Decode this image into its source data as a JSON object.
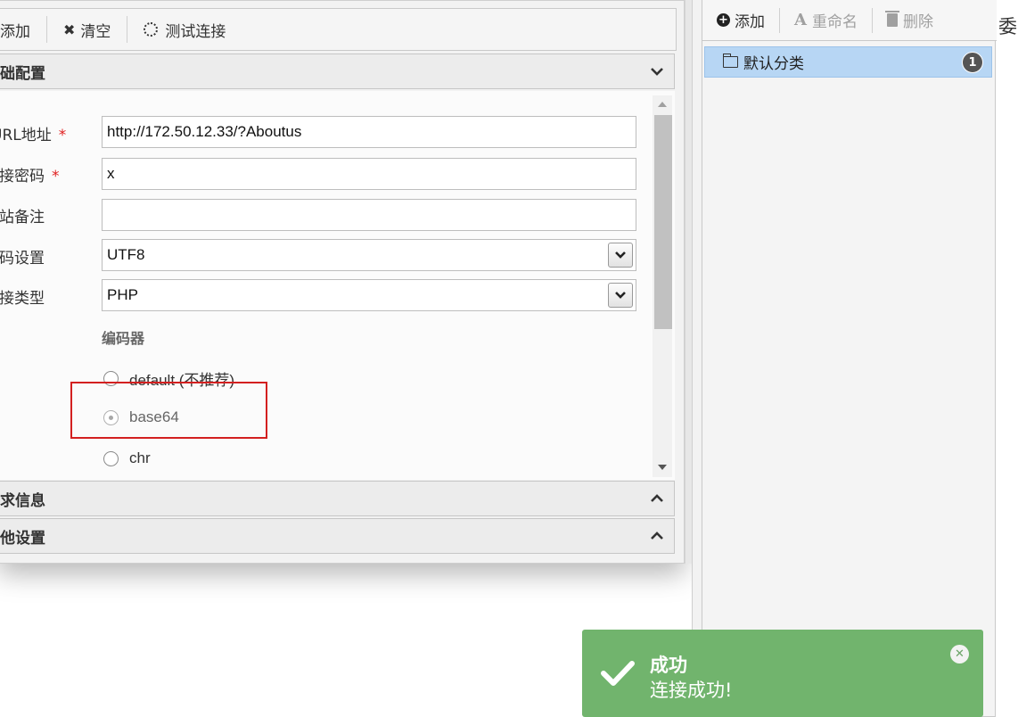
{
  "toolbar": {
    "add_label": "添加",
    "clear_label": "清空",
    "test_label": "测试连接"
  },
  "sections": {
    "basic": "基础配置",
    "request": "请求信息",
    "other": "其他设置"
  },
  "form": {
    "url_label": "URL地址",
    "url_value": "http://172.50.12.33/?Aboutus",
    "password_label": "连接密码",
    "password_value": "x",
    "note_label": "网站备注",
    "note_value": "",
    "encoding_label": "编码设置",
    "encoding_value": "UTF8",
    "type_label": "连接类型",
    "type_value": "PHP",
    "required_mark": "*",
    "encoder_title": "编码器",
    "encoders": [
      {
        "label": "default (不推荐)",
        "checked": false
      },
      {
        "label": "base64",
        "checked": true
      },
      {
        "label": "chr",
        "checked": false
      }
    ]
  },
  "right_panel": {
    "add_label": "添加",
    "rename_label": "重命名",
    "delete_label": "删除",
    "category_label": "默认分类",
    "category_count": "1",
    "edge_char": "委"
  },
  "toast": {
    "title": "成功",
    "message": "连接成功!",
    "color": "#71b46d"
  },
  "icons": [
    "plus-circle-icon",
    "times-icon",
    "spinner-icon",
    "chevron-down-icon",
    "chevron-up-icon",
    "folder-icon",
    "trash-icon",
    "font-icon",
    "check-icon",
    "close-icon"
  ]
}
